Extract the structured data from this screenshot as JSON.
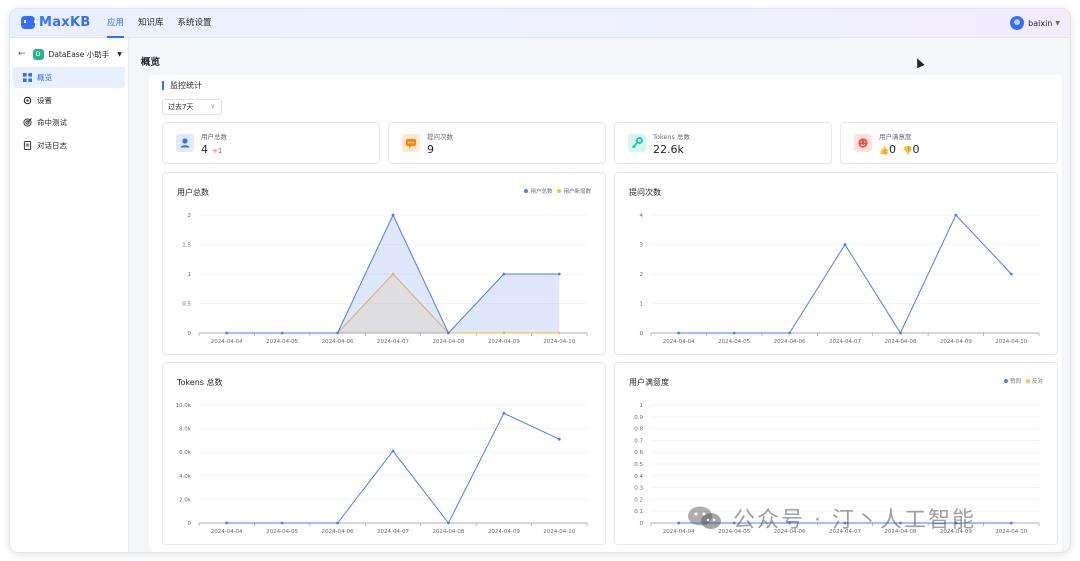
{
  "brand": {
    "name": "MaxKB",
    "color": "#3370ff"
  },
  "topnav": [
    {
      "label": "应用",
      "active": true
    },
    {
      "label": "知识库",
      "active": false
    },
    {
      "label": "系统设置",
      "active": false
    }
  ],
  "user": {
    "name": "baixin"
  },
  "sidebar": {
    "app_name": "DataEase 小助手",
    "app_letter": "D",
    "items": [
      {
        "label": "概览",
        "icon": "grid-icon",
        "active": true
      },
      {
        "label": "设置",
        "icon": "gear-icon",
        "active": false
      },
      {
        "label": "命中测试",
        "icon": "target-icon",
        "active": false
      },
      {
        "label": "对话日志",
        "icon": "document-icon",
        "active": false
      }
    ]
  },
  "page": {
    "title": "概览",
    "section_title": "监控统计",
    "date_range": "过去7天"
  },
  "stats": {
    "users": {
      "label": "用户总数",
      "value": "4",
      "delta": "+1",
      "color": "#3370ff"
    },
    "questions": {
      "label": "提问次数",
      "value": "9",
      "color": "#ff8800"
    },
    "tokens": {
      "label": "Tokens 总数",
      "value": "22.6k",
      "color": "#14c0a0"
    },
    "satisfaction": {
      "label": "用户满意度",
      "like": "0",
      "dislike": "0",
      "color": "#f54a45"
    }
  },
  "chart_data": [
    {
      "type": "area",
      "title": "用户总数",
      "categories": [
        "2024-04-04",
        "2024-04-05",
        "2024-04-06",
        "2024-04-07",
        "2024-04-08",
        "2024-04-09",
        "2024-04-10"
      ],
      "yticks": [
        "0",
        "0.5",
        "1",
        "1.5",
        "2"
      ],
      "ylim": [
        0,
        2
      ],
      "legend": "top-right",
      "series": [
        {
          "name": "用户总数",
          "values": [
            0,
            0,
            0,
            2,
            0,
            1,
            1
          ],
          "color": "#4e7cf0"
        },
        {
          "name": "用户新增数",
          "values": [
            0,
            0,
            0,
            1,
            0,
            0,
            0
          ],
          "color": "#f7c143"
        }
      ]
    },
    {
      "type": "line",
      "title": "提问次数",
      "categories": [
        "2024-04-04",
        "2024-04-05",
        "2024-04-06",
        "2024-04-07",
        "2024-04-08",
        "2024-04-09",
        "2024-04-10"
      ],
      "yticks": [
        "0",
        "1",
        "2",
        "3",
        "4"
      ],
      "ylim": [
        0,
        4
      ],
      "series": [
        {
          "values": [
            0,
            0,
            0,
            3,
            0,
            4,
            2
          ],
          "color": "#4e7cf0"
        }
      ]
    },
    {
      "type": "line",
      "title": "Tokens 总数",
      "categories": [
        "2024-04-04",
        "2024-04-05",
        "2024-04-06",
        "2024-04-07",
        "2024-04-08",
        "2024-04-09",
        "2024-04-10"
      ],
      "yticks": [
        "0",
        "2.0k",
        "4.0k",
        "6.0k",
        "8.0k",
        "10.0k"
      ],
      "ylim": [
        0,
        10000
      ],
      "series": [
        {
          "values": [
            0,
            0,
            0,
            6100,
            0,
            9300,
            7100
          ],
          "color": "#4e7cf0"
        }
      ]
    },
    {
      "type": "line",
      "title": "用户满意度",
      "categories": [
        "2024-04-04",
        "2024-04-05",
        "2024-04-06",
        "2024-04-07",
        "2024-04-08",
        "2024-04-09",
        "2024-04-10"
      ],
      "yticks": [
        "0",
        "0.1",
        "0.2",
        "0.3",
        "0.4",
        "0.5",
        "0.6",
        "0.7",
        "0.8",
        "0.9",
        "1"
      ],
      "ylim": [
        0,
        1
      ],
      "legend": "top-right",
      "series": [
        {
          "name": "赞同",
          "values": [
            0,
            0,
            0,
            0,
            0,
            0,
            0
          ],
          "color": "#4e7cf0"
        },
        {
          "name": "反对",
          "values": [
            0,
            0,
            0,
            0,
            0,
            0,
            0
          ],
          "color": "#f7c143"
        }
      ]
    }
  ],
  "watermark": "公众号 · 汀丶人工智能"
}
